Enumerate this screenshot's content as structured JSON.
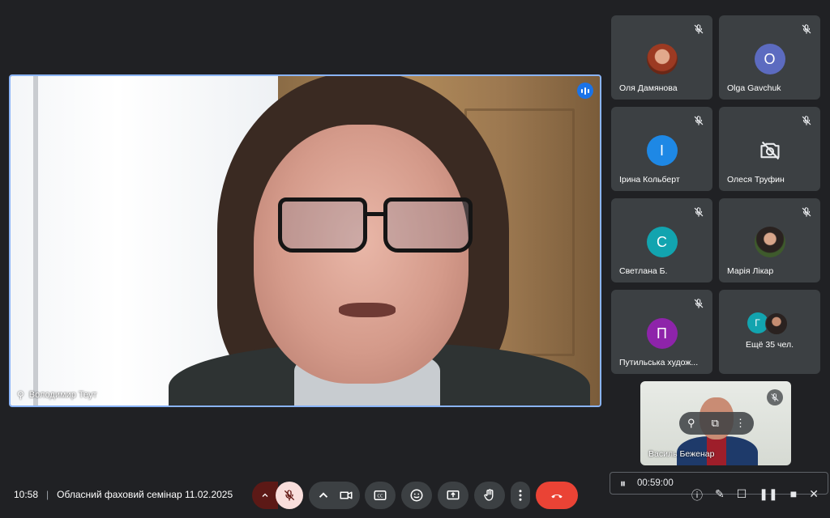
{
  "main_speaker": {
    "name": "Володимир Теут",
    "speaking": true
  },
  "participants": [
    {
      "name": "Оля Дамянова",
      "avatar_type": "photo",
      "muted": true
    },
    {
      "name": "Olga Gavchuk",
      "initial": "O",
      "avatar_color": "#5c6bc0",
      "muted": true
    },
    {
      "name": "Ірина Кольберт",
      "initial": "I",
      "avatar_color": "#1e88e5",
      "muted": true
    },
    {
      "name": "Олеся Труфин",
      "avatar_type": "camera-off",
      "muted": true
    },
    {
      "name": "Светлана Б.",
      "initial": "С",
      "avatar_color": "#12a4af",
      "muted": true
    },
    {
      "name": "Марія Лікар",
      "avatar_type": "photo",
      "muted": true
    },
    {
      "name": "Путильська худож...",
      "initial": "П",
      "avatar_color": "#8e24aa",
      "muted": true
    }
  ],
  "more": {
    "initial": "Г",
    "label": "Ещё 35 чел."
  },
  "self_view": {
    "name": "Василь Беженар",
    "muted": true
  },
  "meeting": {
    "time": "10:58",
    "title": "Обласний фаховий семінар 11.02.2025"
  },
  "recording": {
    "elapsed": "00:59:00"
  },
  "icons": {
    "mic_off": "mic-off-icon",
    "camera": "camera-icon",
    "captions": "captions-icon",
    "emoji": "emoji-icon",
    "present": "present-icon",
    "hand": "hand-icon",
    "more": "more-vert-icon",
    "hangup": "hangup-icon"
  },
  "colors": {
    "accent": "#8ab4f8",
    "hangup": "#ea4335",
    "mic_off_bg": "#f9dedc",
    "surface": "#3c4043"
  }
}
